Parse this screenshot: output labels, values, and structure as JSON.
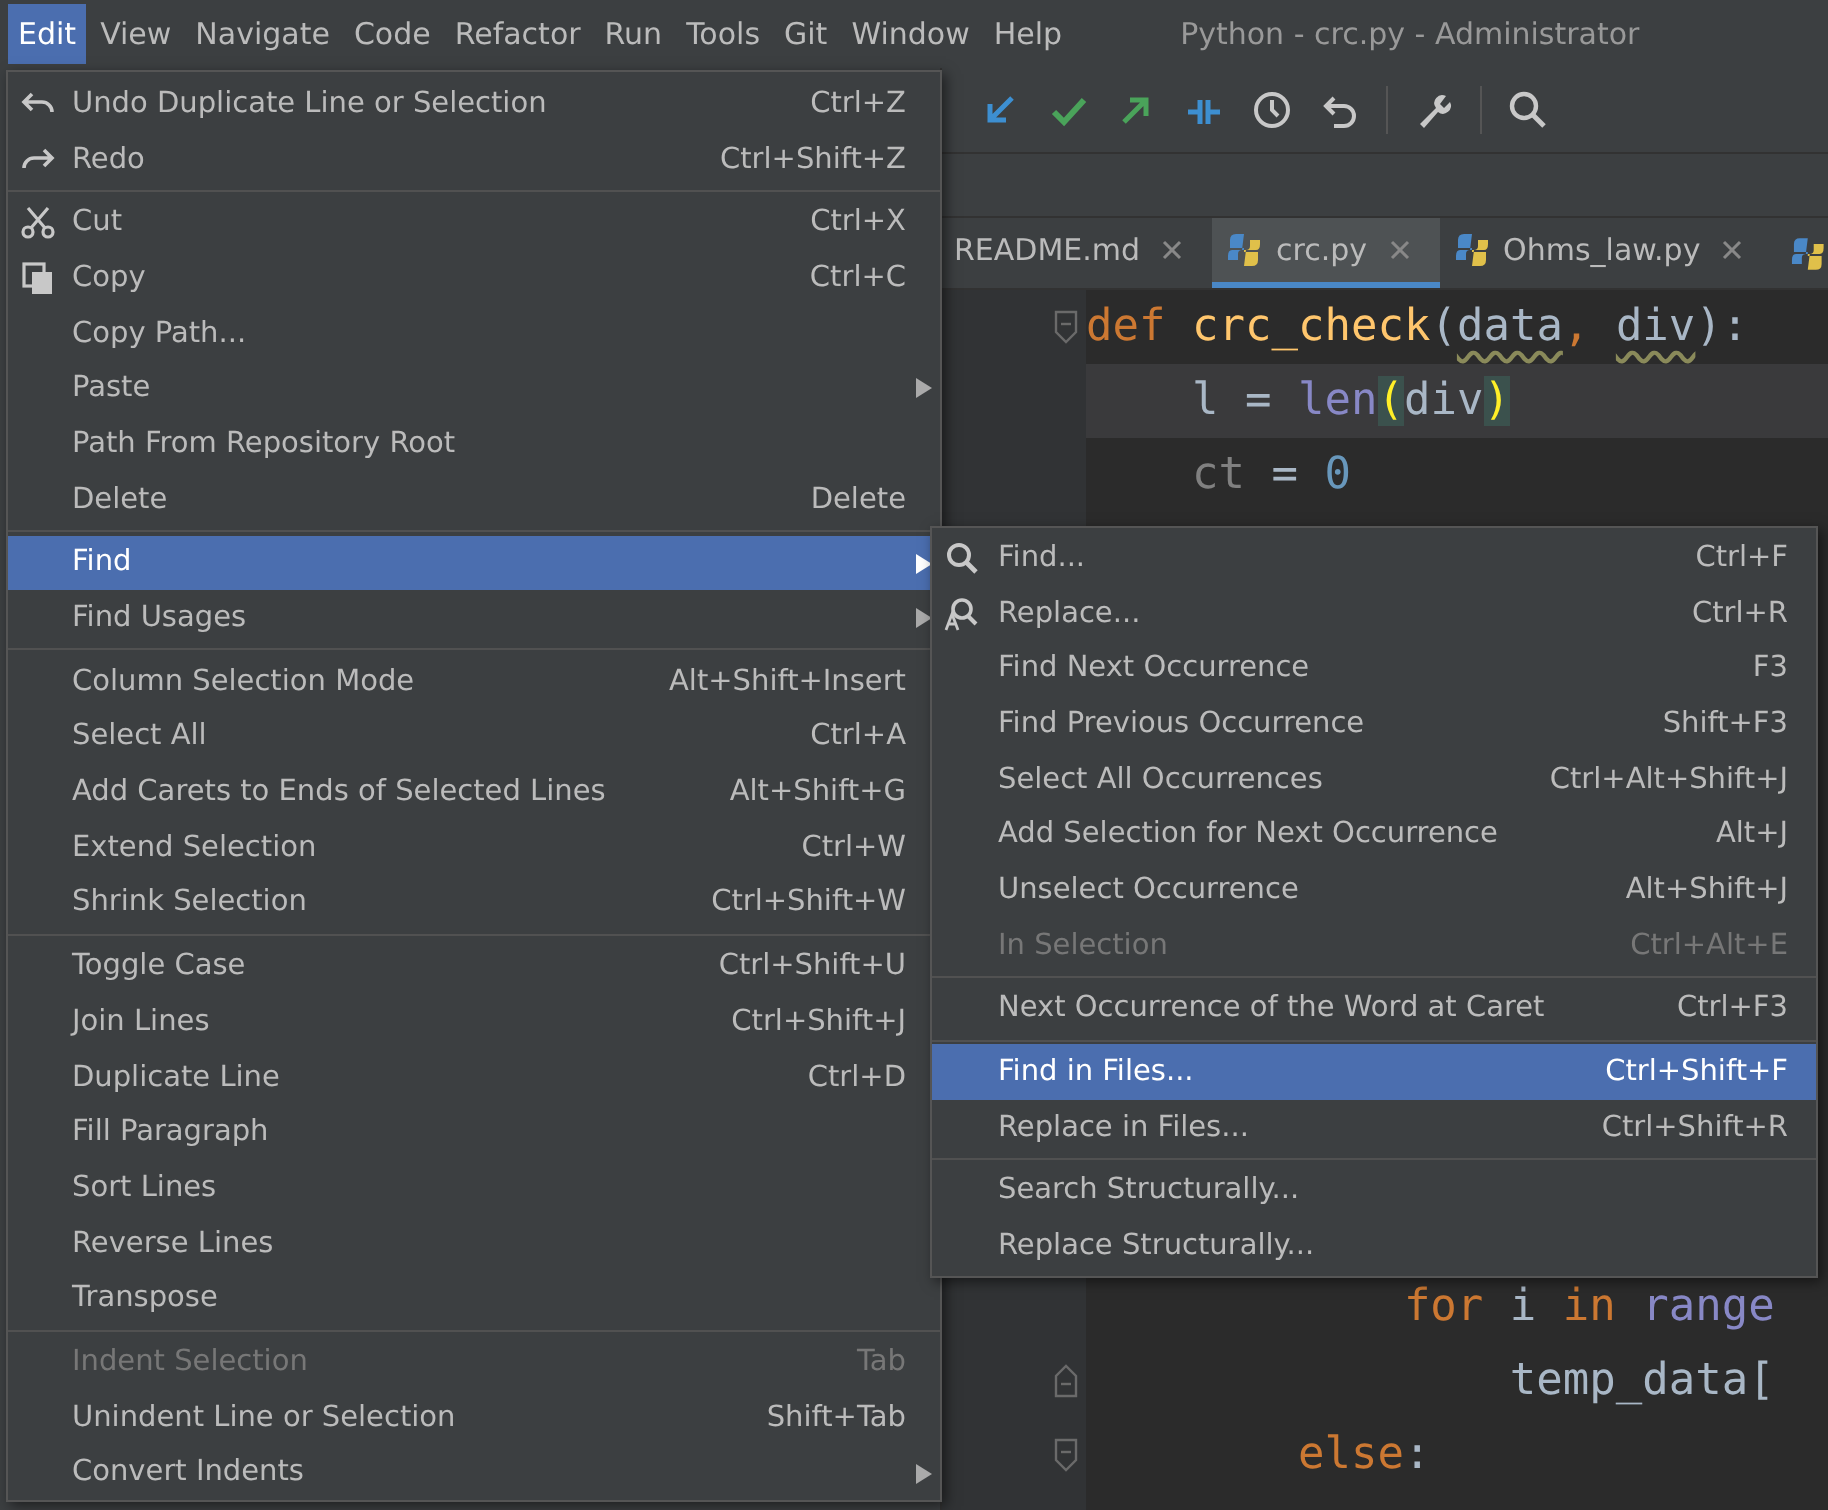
{
  "menubar": {
    "items": [
      {
        "label": "Edit",
        "selected": true
      },
      {
        "label": "View",
        "selected": false
      },
      {
        "label": "Navigate",
        "selected": false
      },
      {
        "label": "Code",
        "selected": false
      },
      {
        "label": "Refactor",
        "selected": false
      },
      {
        "label": "Run",
        "selected": false
      },
      {
        "label": "Tools",
        "selected": false
      },
      {
        "label": "Git",
        "selected": false
      },
      {
        "label": "Window",
        "selected": false
      },
      {
        "label": "Help",
        "selected": false
      }
    ],
    "title": "Python - crc.py - Administrator"
  },
  "tabs": [
    {
      "label": "README.md",
      "selected": false,
      "kind": "markdown"
    },
    {
      "label": "crc.py",
      "selected": true,
      "kind": "python"
    },
    {
      "label": "Ohms_law.py",
      "selected": false,
      "kind": "python"
    }
  ],
  "editor": {
    "top_lines": [
      {
        "current": false,
        "fold_start": true,
        "fold_end": false,
        "tokens": [
          {
            "kind": "keyword",
            "text": "def "
          },
          {
            "kind": "function",
            "text": "crc_check"
          },
          {
            "kind": "plain",
            "text": "("
          },
          {
            "kind": "warn",
            "text": "data"
          },
          {
            "kind": "keyword",
            "text": ", "
          },
          {
            "kind": "warn",
            "text": "div"
          },
          {
            "kind": "plain",
            "text": "):"
          }
        ]
      },
      {
        "current": true,
        "fold_start": false,
        "fold_end": false,
        "tokens": [
          {
            "kind": "plain",
            "text": "    l = "
          },
          {
            "kind": "builtin",
            "text": "len"
          },
          {
            "kind": "brace",
            "text": "("
          },
          {
            "kind": "plain",
            "text": "div"
          },
          {
            "kind": "brace",
            "text": ")"
          }
        ]
      },
      {
        "current": false,
        "fold_start": false,
        "fold_end": false,
        "tokens": [
          {
            "kind": "unused",
            "text": "    ct"
          },
          {
            "kind": "plain",
            "text": " = "
          },
          {
            "kind": "number",
            "text": "0"
          }
        ]
      }
    ],
    "bottom_lines": [
      {
        "current": false,
        "fold_start": false,
        "fold_end": false,
        "tokens": [
          {
            "kind": "keyword",
            "text": "            for "
          },
          {
            "kind": "plain",
            "text": "i "
          },
          {
            "kind": "keyword",
            "text": "in "
          },
          {
            "kind": "builtin",
            "text": "range"
          }
        ]
      },
      {
        "current": false,
        "fold_start": false,
        "fold_end": true,
        "tokens": [
          {
            "kind": "plain",
            "text": "                temp_data["
          }
        ]
      },
      {
        "current": false,
        "fold_start": true,
        "fold_end": false,
        "tokens": [
          {
            "kind": "keyword",
            "text": "        else"
          },
          {
            "kind": "plain",
            "text": ":"
          }
        ]
      }
    ]
  },
  "edit_menu": {
    "sections": [
      {
        "items": [
          {
            "label": "Undo Duplicate Line or Selection",
            "shortcut": "Ctrl+Z",
            "kind": "undo",
            "submenu": false,
            "disabled": false,
            "selected": false
          },
          {
            "label": "Redo",
            "shortcut": "Ctrl+Shift+Z",
            "kind": "redo",
            "submenu": false,
            "disabled": false,
            "selected": false
          }
        ]
      },
      {
        "items": [
          {
            "label": "Cut",
            "shortcut": "Ctrl+X",
            "kind": "cut",
            "submenu": false,
            "disabled": false,
            "selected": false
          },
          {
            "label": "Copy",
            "shortcut": "Ctrl+C",
            "kind": "copy",
            "submenu": false,
            "disabled": false,
            "selected": false
          },
          {
            "label": "Copy Path...",
            "kind": "plain",
            "submenu": false,
            "disabled": false,
            "selected": false
          },
          {
            "label": "Paste",
            "kind": "plain",
            "submenu": true,
            "disabled": false,
            "selected": false
          },
          {
            "label": "Path From Repository Root",
            "kind": "plain",
            "submenu": false,
            "disabled": false,
            "selected": false
          },
          {
            "label": "Delete",
            "shortcut": "Delete",
            "kind": "plain",
            "submenu": false,
            "disabled": false,
            "selected": false
          }
        ]
      },
      {
        "items": [
          {
            "label": "Find",
            "kind": "plain",
            "submenu": true,
            "disabled": false,
            "selected": true
          },
          {
            "label": "Find Usages",
            "kind": "plain",
            "submenu": true,
            "disabled": false,
            "selected": false
          }
        ]
      },
      {
        "items": [
          {
            "label": "Column Selection Mode",
            "shortcut": "Alt+Shift+Insert",
            "kind": "plain",
            "submenu": false,
            "disabled": false,
            "selected": false
          },
          {
            "label": "Select All",
            "shortcut": "Ctrl+A",
            "kind": "plain",
            "submenu": false,
            "disabled": false,
            "selected": false
          },
          {
            "label": "Add Carets to Ends of Selected Lines",
            "shortcut": "Alt+Shift+G",
            "kind": "plain",
            "submenu": false,
            "disabled": false,
            "selected": false
          },
          {
            "label": "Extend Selection",
            "shortcut": "Ctrl+W",
            "kind": "plain",
            "submenu": false,
            "disabled": false,
            "selected": false
          },
          {
            "label": "Shrink Selection",
            "shortcut": "Ctrl+Shift+W",
            "kind": "plain",
            "submenu": false,
            "disabled": false,
            "selected": false
          }
        ]
      },
      {
        "items": [
          {
            "label": "Toggle Case",
            "shortcut": "Ctrl+Shift+U",
            "kind": "plain",
            "submenu": false,
            "disabled": false,
            "selected": false
          },
          {
            "label": "Join Lines",
            "shortcut": "Ctrl+Shift+J",
            "kind": "plain",
            "submenu": false,
            "disabled": false,
            "selected": false
          },
          {
            "label": "Duplicate Line",
            "shortcut": "Ctrl+D",
            "kind": "plain",
            "submenu": false,
            "disabled": false,
            "selected": false
          },
          {
            "label": "Fill Paragraph",
            "kind": "plain",
            "submenu": false,
            "disabled": false,
            "selected": false
          },
          {
            "label": "Sort Lines",
            "kind": "plain",
            "submenu": false,
            "disabled": false,
            "selected": false
          },
          {
            "label": "Reverse Lines",
            "kind": "plain",
            "submenu": false,
            "disabled": false,
            "selected": false
          },
          {
            "label": "Transpose",
            "kind": "plain",
            "submenu": false,
            "disabled": false,
            "selected": false
          }
        ]
      },
      {
        "items": [
          {
            "label": "Indent Selection",
            "shortcut": "Tab",
            "kind": "plain",
            "submenu": false,
            "disabled": true,
            "selected": false
          },
          {
            "label": "Unindent Line or Selection",
            "shortcut": "Shift+Tab",
            "kind": "plain",
            "submenu": false,
            "disabled": false,
            "selected": false
          },
          {
            "label": "Convert Indents",
            "kind": "plain",
            "submenu": true,
            "disabled": false,
            "selected": false
          }
        ]
      }
    ]
  },
  "find_menu": {
    "sections": [
      {
        "items": [
          {
            "label": "Find...",
            "shortcut": "Ctrl+F",
            "kind": "search",
            "disabled": false,
            "selected": false
          },
          {
            "label": "Replace...",
            "shortcut": "Ctrl+R",
            "kind": "replace",
            "disabled": false,
            "selected": false
          },
          {
            "label": "Find Next Occurrence",
            "shortcut": "F3",
            "kind": "plain",
            "disabled": false,
            "selected": false
          },
          {
            "label": "Find Previous Occurrence",
            "shortcut": "Shift+F3",
            "kind": "plain",
            "disabled": false,
            "selected": false
          },
          {
            "label": "Select All Occurrences",
            "shortcut": "Ctrl+Alt+Shift+J",
            "kind": "plain",
            "disabled": false,
            "selected": false
          },
          {
            "label": "Add Selection for Next Occurrence",
            "shortcut": "Alt+J",
            "kind": "plain",
            "disabled": false,
            "selected": false
          },
          {
            "label": "Unselect Occurrence",
            "shortcut": "Alt+Shift+J",
            "kind": "plain",
            "disabled": false,
            "selected": false
          },
          {
            "label": "In Selection",
            "shortcut": "Ctrl+Alt+E",
            "kind": "plain",
            "disabled": true,
            "selected": false
          }
        ]
      },
      {
        "items": [
          {
            "label": "Next Occurrence of the Word at Caret",
            "shortcut": "Ctrl+F3",
            "kind": "plain",
            "disabled": false,
            "selected": false
          }
        ]
      },
      {
        "items": [
          {
            "label": "Find in Files...",
            "shortcut": "Ctrl+Shift+F",
            "kind": "plain",
            "disabled": false,
            "selected": true
          },
          {
            "label": "Replace in Files...",
            "shortcut": "Ctrl+Shift+R",
            "kind": "plain",
            "disabled": false,
            "selected": false
          }
        ]
      },
      {
        "items": [
          {
            "label": "Search Structurally...",
            "kind": "plain",
            "disabled": false,
            "selected": false
          },
          {
            "label": "Replace Structurally...",
            "kind": "plain",
            "disabled": false,
            "selected": false
          }
        ]
      }
    ]
  }
}
